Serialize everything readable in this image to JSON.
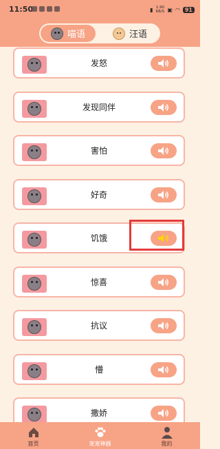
{
  "status_bar": {
    "time": "11:50",
    "net_speed_value": "1.90",
    "net_speed_unit": "KB/S",
    "battery": "91"
  },
  "header": {
    "tabs": [
      {
        "label": "喵语",
        "icon": "cat-icon",
        "active": true
      },
      {
        "label": "汪语",
        "icon": "dog-icon",
        "active": false
      }
    ]
  },
  "sounds": [
    {
      "label": "发怒"
    },
    {
      "label": "发现同伴"
    },
    {
      "label": "害怕"
    },
    {
      "label": "好奇"
    },
    {
      "label": "饥饿",
      "playing": true
    },
    {
      "label": "惊喜"
    },
    {
      "label": "抗议"
    },
    {
      "label": "懵"
    },
    {
      "label": "撒娇"
    }
  ],
  "tabbar": {
    "items": [
      {
        "label": "首页",
        "icon": "home-icon"
      },
      {
        "label": "宠宠神器",
        "icon": "paw-icon",
        "active": true
      },
      {
        "label": "我的",
        "icon": "person-icon"
      }
    ]
  },
  "colors": {
    "accent": "#f7a386",
    "background": "#fdf1e4",
    "card_border": "#f7b5a5",
    "thumb": "#f39aa0",
    "speaker": "#ffffff",
    "speaker_playing": "#ffd700",
    "highlight": "#e53a3a"
  }
}
